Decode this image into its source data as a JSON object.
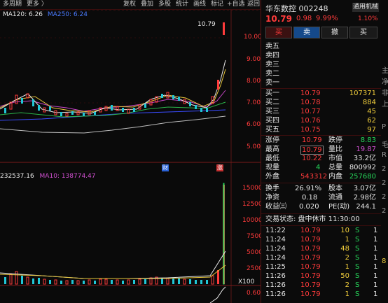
{
  "toolbar": {
    "left": [
      "多周期",
      "更多 〉"
    ],
    "right": [
      "复权",
      "叠加",
      "多股",
      "统计",
      "画线",
      "标记",
      "+自选",
      "返回"
    ]
  },
  "ma_legend": {
    "ma120": "MA120: 6.26",
    "ma250": "MA250: 6.24"
  },
  "price_tag": "10.79",
  "price_axis": [
    "10.00",
    "9.00",
    "8.00",
    "7.00",
    "6.00",
    "5.00"
  ],
  "markers": {
    "cai": "财",
    "zhang": "涨"
  },
  "vol_legend": {
    "ma5": "232537.16",
    "ma10": "MA10: 138774.47"
  },
  "vol_axis": [
    "15000",
    "12500",
    "10000",
    "7500",
    "5000",
    "2500"
  ],
  "vol_unit": "X100",
  "lower_axis": "0.60",
  "stock": {
    "name": "华东数控",
    "code": "002248",
    "price": "10.79",
    "change": "0.98",
    "change_pct": "9.99%",
    "sector": "通用机械",
    "sector_pct": "1.10%"
  },
  "trade_buttons": [
    "买",
    "卖",
    "撤",
    "买"
  ],
  "sell_levels": [
    "卖五",
    "卖四",
    "卖三",
    "卖二",
    "卖一"
  ],
  "buy_levels": [
    {
      "label": "买一",
      "price": "10.79",
      "vol": "107371"
    },
    {
      "label": "买二",
      "price": "10.78",
      "vol": "884"
    },
    {
      "label": "买三",
      "price": "10.77",
      "vol": "45"
    },
    {
      "label": "买四",
      "price": "10.76",
      "vol": "62"
    },
    {
      "label": "买五",
      "price": "10.75",
      "vol": "97"
    }
  ],
  "stats": [
    {
      "l1": "涨停",
      "v1": "10.79",
      "l2": "跌停",
      "v2": "8.83"
    },
    {
      "l1": "最高",
      "v1": "10.79",
      "l2": "量比",
      "v2": "19.87"
    },
    {
      "l1": "最低",
      "v1": "10.22",
      "l2": "市值",
      "v2": "33.2亿"
    },
    {
      "l1": "现量",
      "v1": "4",
      "l2": "总量",
      "v2": "800992"
    },
    {
      "l1": "外盘",
      "v1": "543312",
      "l2": "内盘",
      "v2": "257680"
    },
    {
      "l1": "换手",
      "v1": "26.91%",
      "l2": "股本",
      "v2": "3.07亿"
    },
    {
      "l1": "净资",
      "v1": "0.18",
      "l2": "流通",
      "v2": "2.98亿"
    },
    {
      "l1": "收益㈢",
      "v1": "0.020",
      "l2": "PE(动)",
      "v2": "244.1"
    }
  ],
  "trade_status": "交易状态: 盘中休市 11:30:00",
  "ticks": [
    {
      "time": "11:22",
      "price": "10.79",
      "vol": "10",
      "side": "S",
      "n": "1"
    },
    {
      "time": "11:24",
      "price": "10.79",
      "vol": "1",
      "side": "S",
      "n": "1"
    },
    {
      "time": "11:24",
      "price": "10.79",
      "vol": "48",
      "side": "S",
      "n": "1"
    },
    {
      "time": "11:24",
      "price": "10.79",
      "vol": "2",
      "side": "S",
      "n": "1"
    },
    {
      "time": "11:25",
      "price": "10.79",
      "vol": "1",
      "side": "S",
      "n": "1"
    },
    {
      "time": "11:26",
      "price": "10.79",
      "vol": "50",
      "side": "S",
      "n": "1"
    },
    {
      "time": "11:26",
      "price": "10.79",
      "vol": "2",
      "side": "S",
      "n": "1"
    },
    {
      "time": "11:26",
      "price": "10.79",
      "vol": "1",
      "side": "S",
      "n": "1"
    }
  ],
  "edge_text": [
    "主",
    "净",
    "非",
    "上",
    "P",
    "毛",
    "R",
    "2",
    "2",
    "2",
    "2",
    "8"
  ]
}
